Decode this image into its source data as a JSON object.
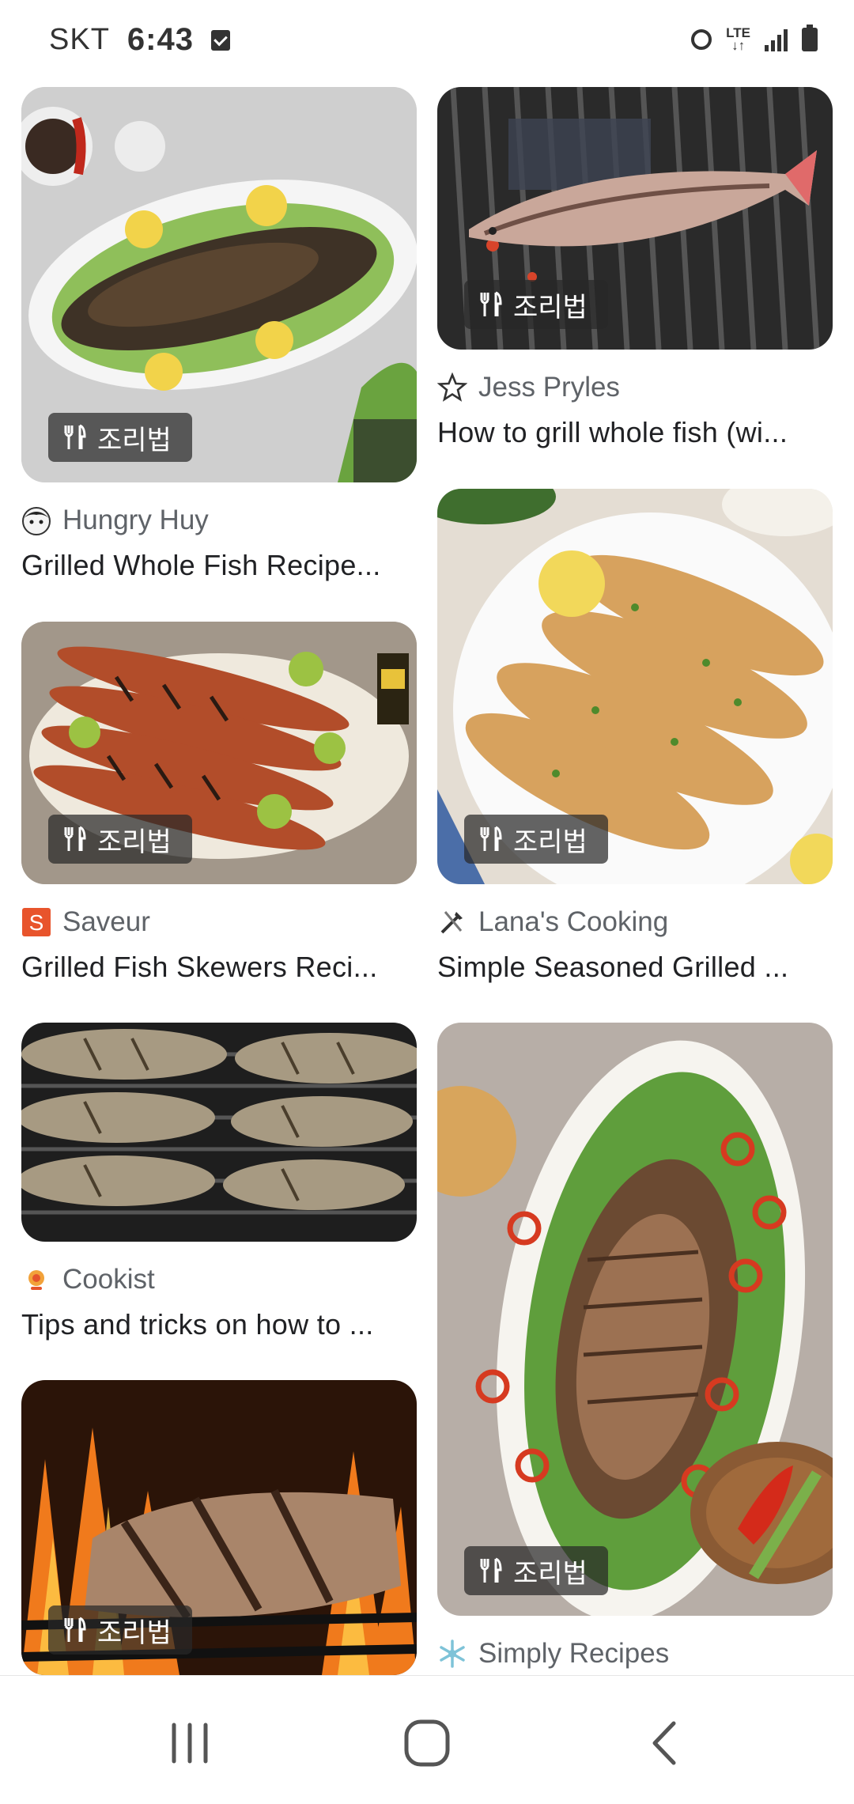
{
  "status_bar": {
    "carrier": "SKT",
    "time": "6:43",
    "network": "LTE"
  },
  "cards": [
    {
      "source": "Hungry Huy",
      "title": "Grilled Whole Fish Recipe...",
      "badge": "조리법",
      "favicon": "boy-face-icon"
    },
    {
      "source": "Jess Pryles",
      "title": "How to grill whole fish (wi...",
      "badge": "조리법",
      "favicon": "star-outline-icon"
    },
    {
      "source": "Saveur",
      "title": "Grilled Fish Skewers Reci...",
      "badge": "조리법",
      "favicon": "saveur-s-icon"
    },
    {
      "source": "Lana's Cooking",
      "title": "Simple Seasoned Grilled ...",
      "badge": "조리법",
      "favicon": "knife-fork-icon"
    },
    {
      "source": "Cookist",
      "title": "Tips and tricks on how to ...",
      "favicon": "cookist-icon"
    },
    {
      "badge": "조리법"
    },
    {
      "source": "Simply Recipes",
      "badge": "조리법",
      "favicon": "snowflake-icon"
    }
  ],
  "colors": {
    "chip_background": "#282828",
    "source_text": "#5f6368",
    "title_text": "#202124",
    "saveur_orange": "#e8542c"
  },
  "nav_bar": {
    "recent": "recent-apps-icon",
    "home": "home-icon",
    "back": "back-icon"
  }
}
